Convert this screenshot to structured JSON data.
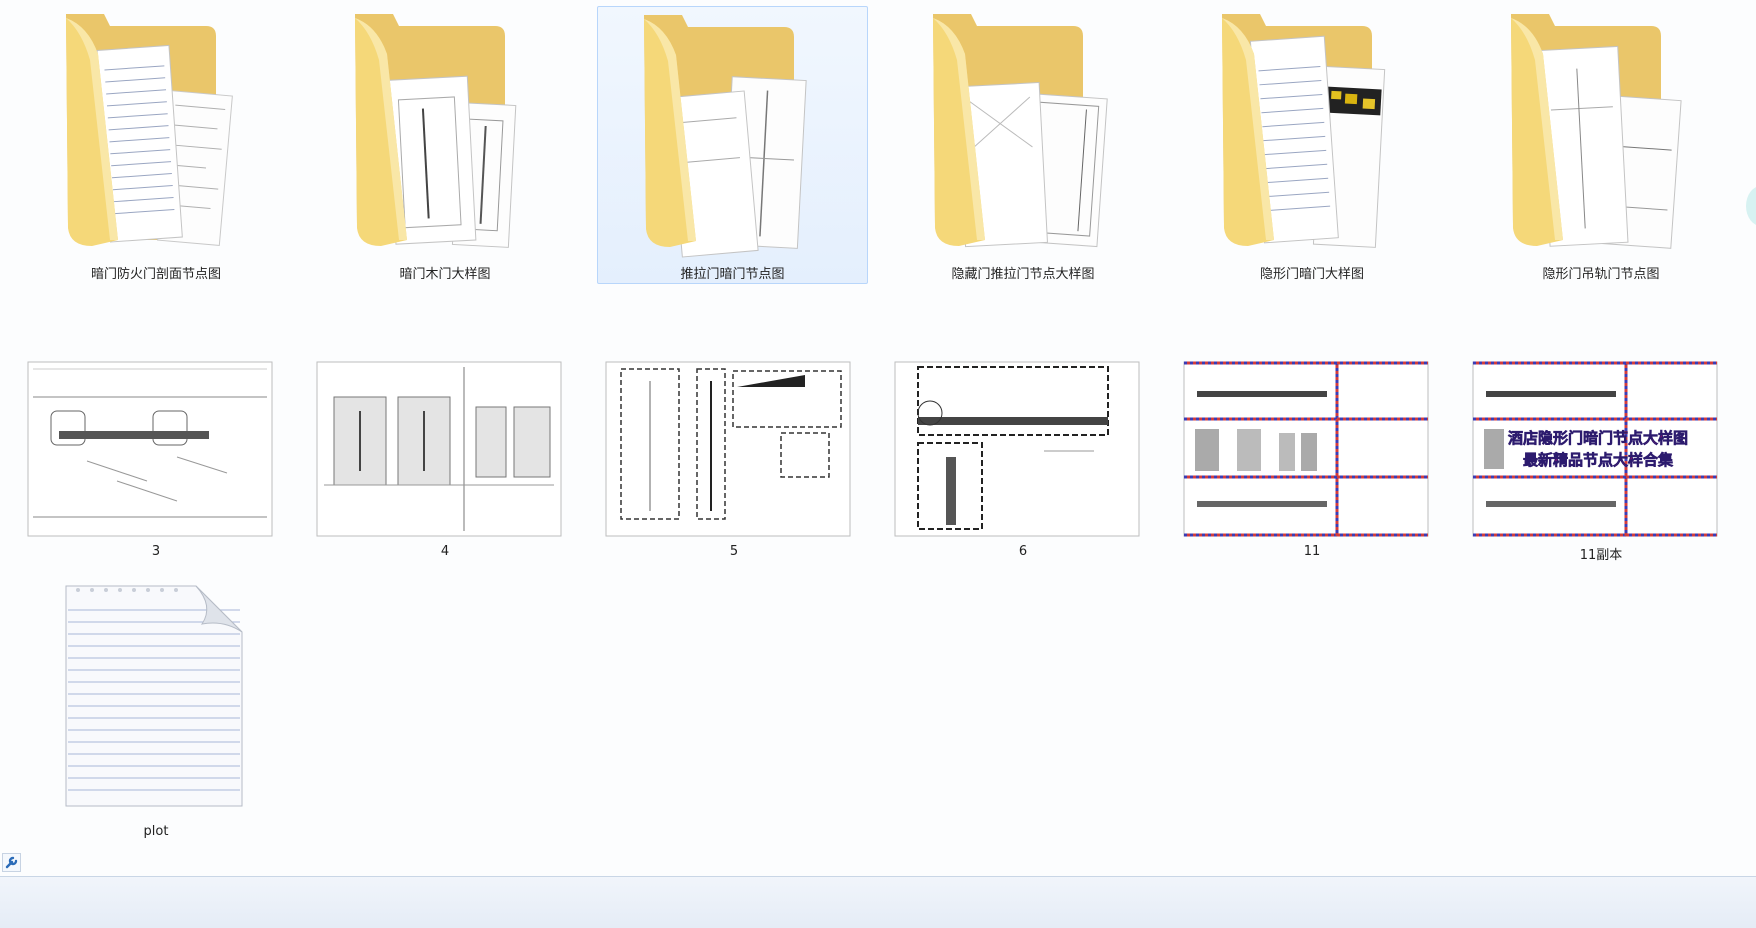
{
  "folders": [
    {
      "label": "暗门防火门剖面节点图",
      "icon": "folder-icon"
    },
    {
      "label": "暗门木门大样图",
      "icon": "folder-icon"
    },
    {
      "label": "推拉门暗门节点图",
      "icon": "folder-icon",
      "selected": true
    },
    {
      "label": "隐藏门推拉门节点大样图",
      "icon": "folder-icon"
    },
    {
      "label": "隐形门暗门大样图",
      "icon": "folder-icon"
    },
    {
      "label": "隐形门吊轨门节点图",
      "icon": "folder-icon"
    }
  ],
  "images": [
    {
      "label": "3",
      "icon": "drawing-thumbnail"
    },
    {
      "label": "4",
      "icon": "drawing-thumbnail"
    },
    {
      "label": "5",
      "icon": "drawing-thumbnail"
    },
    {
      "label": "6",
      "icon": "drawing-thumbnail"
    },
    {
      "label": "11",
      "icon": "drawing-thumbnail"
    },
    {
      "label": "11副本",
      "icon": "drawing-thumbnail",
      "overlay": [
        "酒店隐形门暗门节点大样图",
        "最新精品节点大样合集"
      ]
    }
  ],
  "files": [
    {
      "label": "plot",
      "icon": "text-document-icon"
    }
  ],
  "status_bar": {
    "icon": "wrench-icon"
  },
  "colors": {
    "folder": "#f3d57c",
    "selection": "#e4effd",
    "overlay_text": "#c8006e"
  }
}
